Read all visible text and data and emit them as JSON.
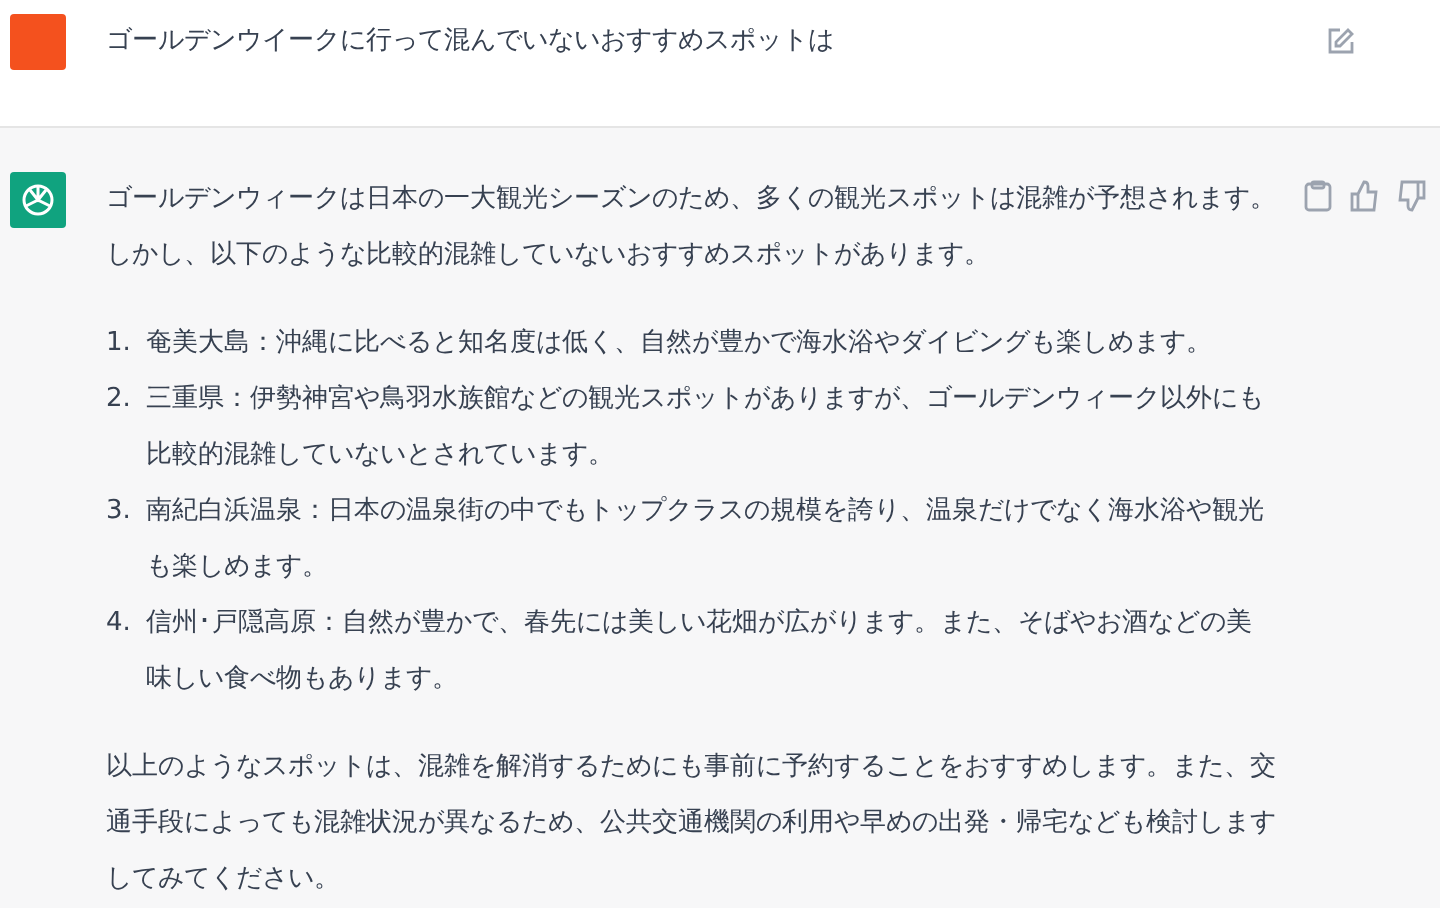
{
  "user_message": {
    "text": "ゴールデンウイークに行って混んでいないおすすめスポットは"
  },
  "assistant_message": {
    "intro": "ゴールデンウィークは日本の一大観光シーズンのため、多くの観光スポットは混雑が予想されます。しかし、以下のような比較的混雑していないおすすめスポットがあります。",
    "list": [
      {
        "number": "1.",
        "text": "奄美大島：沖縄に比べると知名度は低く、自然が豊かで海水浴やダイビングも楽しめます。"
      },
      {
        "number": "2.",
        "text": "三重県：伊勢神宮や鳥羽水族館などの観光スポットがありますが、ゴールデンウィーク以外にも比較的混雑していないとされています。"
      },
      {
        "number": "3.",
        "text": "南紀白浜温泉：日本の温泉街の中でもトップクラスの規模を誇り、温泉だけでなく海水浴や観光も楽しめます。"
      },
      {
        "number": "4.",
        "text": "信州･戸隠高原：自然が豊かで、春先には美しい花畑が広がります。また、そばやお酒などの美味しい食べ物もあります。"
      }
    ],
    "closing": "以上のようなスポットは、混雑を解消するためにも事前に予約することをおすすめします。また、交通手段によっても混雑状況が異なるため、公共交通機関の利用や早めの出発・帰宅なども検討しますしてみてください。"
  }
}
